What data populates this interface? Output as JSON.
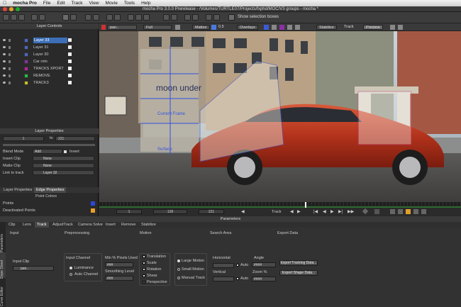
{
  "menubar": {
    "items": [
      "mocha Pro",
      "File",
      "Edit",
      "Track",
      "View",
      "Movie",
      "Tools",
      "Help"
    ]
  },
  "window": {
    "title": "mocha Pro 3.0.0 Prerelease - /Volumes/TURTLE07/Projects/fxphd/MOC/V3 groups - mocha *"
  },
  "toolbar": {
    "show_selection_boxes": "Show selection boxes"
  },
  "layer_controls": {
    "title": "Layer Controls",
    "layers": [
      {
        "name": "Layer 33",
        "color": "#4a66c8"
      },
      {
        "name": "Layer 31",
        "color": "#4a66c8"
      },
      {
        "name": "Layer 30",
        "color": "#4a66c8"
      },
      {
        "name": "Car roto",
        "color": "#8a2fa6"
      },
      {
        "name": "TRACKS XPORT",
        "color": "#c020a0"
      },
      {
        "name": "REMOVE",
        "color": "#20c040"
      },
      {
        "name": "TRACK3",
        "color": "#c8c020"
      }
    ]
  },
  "layer_properties": {
    "title": "Layer Properties",
    "in": "1",
    "out_label": "to",
    "out": "221",
    "blend_mode_label": "Blend Mode",
    "blend_mode": "Add",
    "invert_label": "Invert",
    "insert_clip_label": "Insert Clip",
    "insert_clip": "None",
    "matte_clip_label": "Matte Clip",
    "matte_clip": "None",
    "link_label": "Link to track",
    "link": "Layer 32"
  },
  "edge_panel": {
    "tabs": [
      "Layer Properties",
      "Edge Properties"
    ],
    "point_colors": "Point Colors",
    "points": "Points",
    "deactivated": "Deactivated Points"
  },
  "viewer_bar": {
    "clip": "pan..",
    "view": "Full",
    "mattes": "Mattes",
    "value": "0.5",
    "overlays": "Overlays",
    "stabilize": "Stabilize",
    "track": "Track",
    "preview": "Preview"
  },
  "viewer": {
    "overlay_text_1": "moon under",
    "overlay_text_2": "Current Frame",
    "overlay_text_3": "Surface"
  },
  "timeline": {
    "start": "1",
    "current": "128",
    "end": "221",
    "track_label": "Track",
    "playhead_fraction": 0.57
  },
  "parameters": {
    "title": "Parameters",
    "tabs": [
      "Clip",
      "Lens",
      "Track",
      "AdjustTrack",
      "Camera Solve",
      "Insert",
      "Remove",
      "Stabilize"
    ],
    "active_tab": "Track",
    "side_tabs": [
      "Parameters",
      "Dope Sheet",
      "Curve Editor"
    ],
    "headers": {
      "input": "Input",
      "preprocessing": "Preprocessing",
      "motion": "Motion",
      "search_area": "Search Area",
      "export": "Export Data"
    },
    "input_clip_label": "Input Clip",
    "input_clip": "pan..",
    "input_channel_label": "Input Channel",
    "luminance": "Luminance",
    "auto_channel": "Auto Channel",
    "min_pixels_label": "Min % Pixels Used",
    "min_pixels": "###",
    "smoothing_label": "Smoothing Level",
    "smoothing": "###",
    "motion": [
      "Translation",
      "Scale",
      "Rotation",
      "Shear",
      "Perspective"
    ],
    "large_motion": "Large Motion",
    "small_motion": "Small Motion",
    "manual_track": "Manual Track",
    "horizontal": "Horizontal",
    "vertical": "Vertical",
    "auto": "Auto",
    "angle": "Angle",
    "zoom": "Zoom %",
    "hash": "####",
    "export_tracking": "Export Tracking Data...",
    "export_shape": "Export Shape Data..."
  }
}
